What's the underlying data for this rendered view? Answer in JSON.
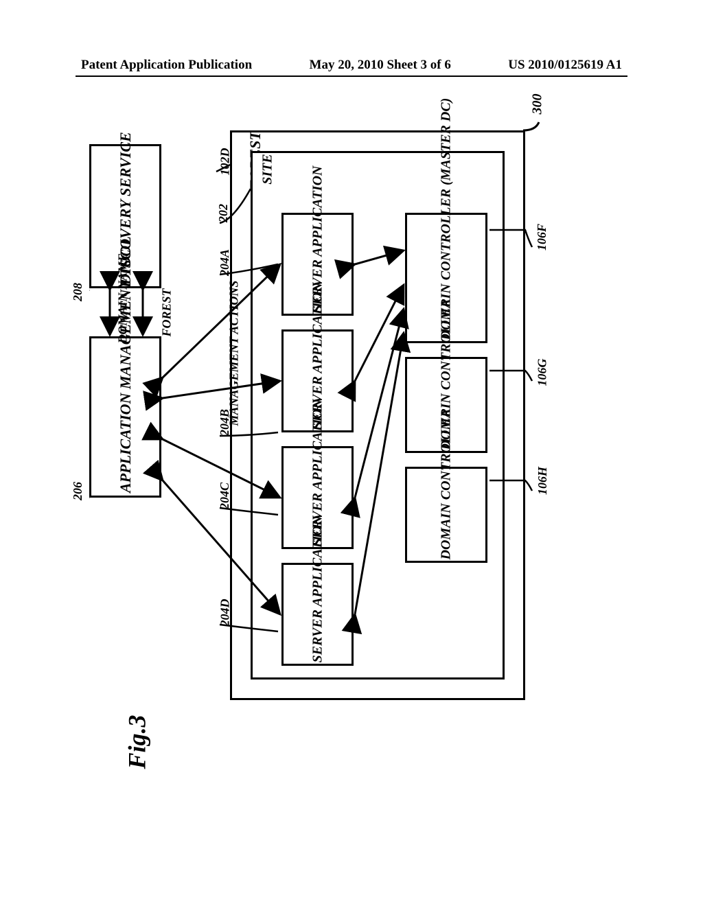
{
  "header": {
    "left": "Patent Application Publication",
    "center": "May 20, 2010  Sheet 3 of 6",
    "right": "US 2010/0125619 A1"
  },
  "labels": {
    "fig_number": "300",
    "forest_box": "FOREST",
    "site_box": "SITE",
    "forest_id": "102D",
    "site_id": "202",
    "dc_master": "DOMAIN CONTROLLER (MASTER DC)",
    "dc": "DOMAIN CONTROLLER",
    "dc_f": "106F",
    "dc_g": "106G",
    "dc_h": "106H",
    "server_app": "SERVER APPLICATION",
    "sa_a": "204A",
    "sa_b": "204B",
    "sa_c": "204C",
    "sa_d": "204D",
    "mgmt_actions": "MANAGEMENT ACTIONS",
    "discovery": "DISCOVERY SERVICE",
    "discovery_id": "208",
    "domain_name": "DOMAIN NAME",
    "forest_arrow": "FOREST",
    "app_mgmt": "APPLICATION MANAGEMENT TOOL",
    "app_mgmt_id": "206",
    "figure": "Fig.3"
  }
}
